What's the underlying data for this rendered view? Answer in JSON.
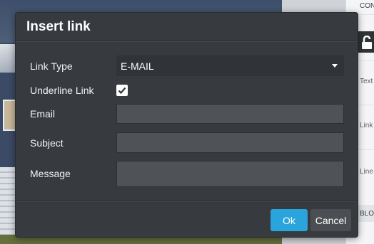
{
  "dialog": {
    "title": "Insert link",
    "link_type": {
      "label": "Link Type",
      "value": "E-MAIL"
    },
    "underline": {
      "label": "Underline Link",
      "checked": true
    },
    "email": {
      "label": "Email",
      "value": ""
    },
    "subject": {
      "label": "Subject",
      "value": ""
    },
    "message": {
      "label": "Message",
      "value": ""
    },
    "ok_label": "Ok",
    "cancel_label": "Cancel"
  },
  "side_panel": {
    "labels": [
      "CON",
      "Text",
      "Link",
      "Line",
      "BLO"
    ],
    "lock_icon": "lock-open-icon"
  },
  "colors": {
    "dialog_bg": "#373b3f",
    "input_bg": "#4f5357",
    "select_bg": "#303337",
    "ok_button": "#2aa4dc",
    "cancel_button": "#4b4f53"
  }
}
